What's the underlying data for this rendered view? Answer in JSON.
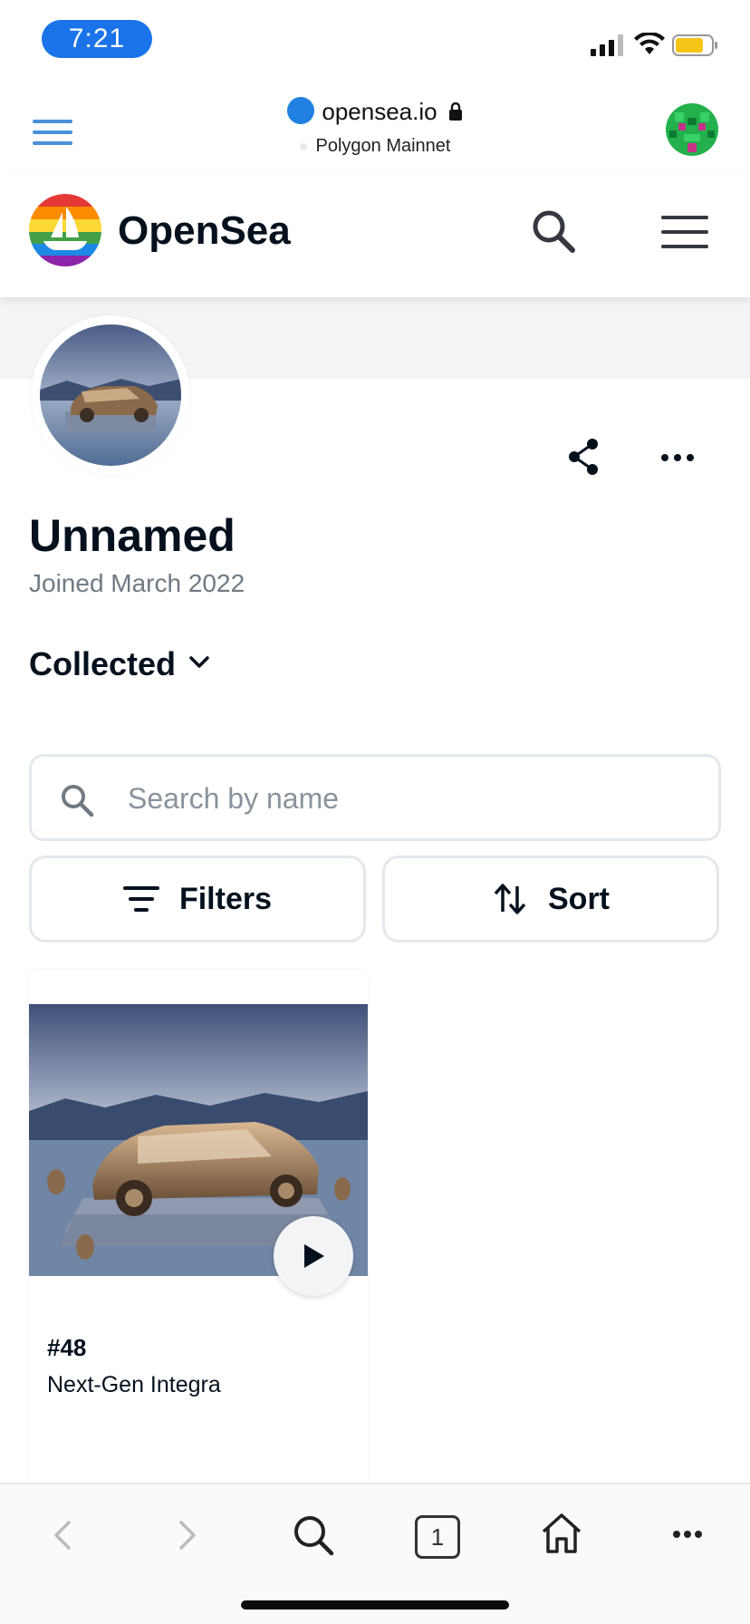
{
  "status_bar": {
    "time": "7:21"
  },
  "browser": {
    "url": "opensea.io",
    "network": "Polygon Mainnet"
  },
  "header": {
    "brand": "OpenSea"
  },
  "profile": {
    "name": "Unnamed",
    "joined": "Joined March 2022",
    "tab": "Collected"
  },
  "search": {
    "placeholder": "Search by name"
  },
  "buttons": {
    "filters": "Filters",
    "sort": "Sort"
  },
  "items": [
    {
      "id": "#48",
      "name": "Next-Gen Integra"
    }
  ],
  "toolbar": {
    "tab_count": "1"
  },
  "colors": {
    "accent": "#2081e2",
    "time_pill": "#1a73e8",
    "text_primary": "#04111d",
    "text_secondary": "#707a83",
    "border": "#e5e8eb"
  }
}
